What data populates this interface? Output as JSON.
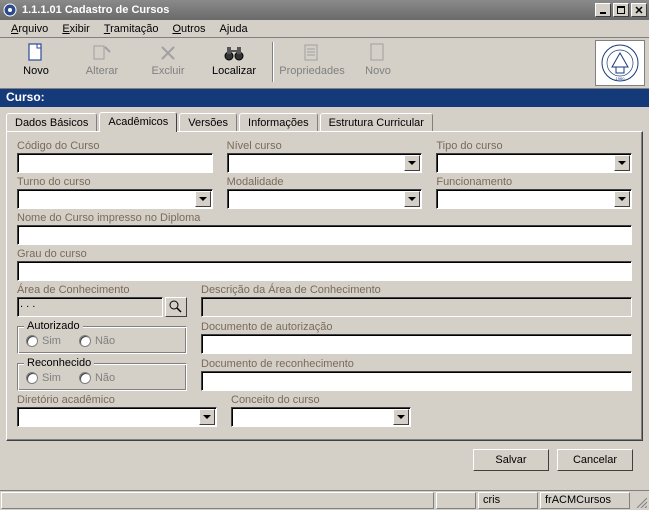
{
  "window": {
    "title": "1.1.1.01 Cadastro de Cursos"
  },
  "menu": {
    "arquivo": "Arquivo",
    "exibir": "Exibir",
    "tramitacao": "Tramitação",
    "outros": "Outros",
    "ajuda": "Ajuda"
  },
  "toolbar": {
    "novo": "Novo",
    "alterar": "Alterar",
    "excluir": "Excluir",
    "localizar": "Localizar",
    "propriedades": "Propriedades",
    "novo2": "Novo"
  },
  "curso_header": "Curso:",
  "tabs": {
    "dados": "Dados Básicos",
    "academicos": "Acadêmicos",
    "versoes": "Versões",
    "informacoes": "Informações",
    "estrutura": "Estrutura Curricular"
  },
  "labels": {
    "codigo": "Código do Curso",
    "nivel": "Nível curso",
    "tipo": "Tipo do curso",
    "turno": "Turno do curso",
    "modalidade": "Modalidade",
    "funcionamento": "Funcionamento",
    "nome_diploma": "Nome do Curso impresso no Diploma",
    "grau": "Grau do curso",
    "area": "Área de Conhecimento",
    "area_val": ". . .",
    "desc_area": "Descrição da Área de Conhecimento",
    "autorizado": "Autorizado",
    "doc_aut": "Documento de autorização",
    "reconhecido": "Reconhecido",
    "doc_rec": "Documento de reconhecimento",
    "diretorio": "Diretório acadêmico",
    "conceito": "Conceito do curso",
    "sim": "Sim",
    "nao": "Não"
  },
  "buttons": {
    "salvar": "Salvar",
    "cancelar": "Cancelar"
  },
  "status": {
    "user": "cris",
    "form": "frACMCursos"
  }
}
